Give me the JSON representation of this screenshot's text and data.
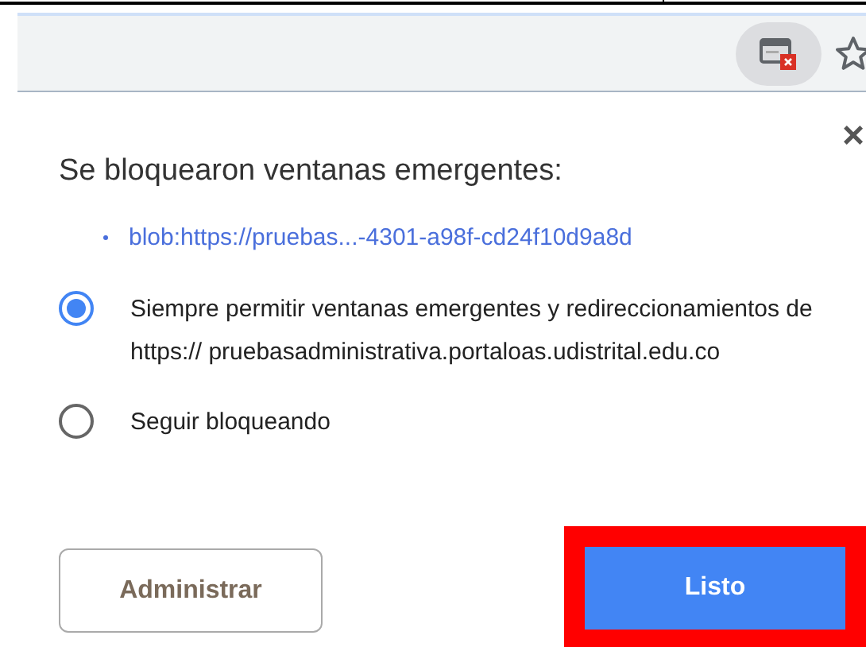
{
  "toolbar": {
    "popup_blocked_indicator": {
      "active": true
    }
  },
  "dialog": {
    "close": "×",
    "title": "Se bloquearon ventanas emergentes:",
    "blocked_links": [
      "blob:https://pruebas...-4301-a98f-cd24f10d9a8d"
    ],
    "options": [
      {
        "label": "Siempre permitir ventanas emergentes y redireccionamientos de https:// pruebasadministrativa.portaloas.udistrital.edu.co",
        "selected": true
      },
      {
        "label": "Seguir bloqueando",
        "selected": false
      }
    ],
    "buttons": [
      {
        "label": "Administrar",
        "kind": "secondary",
        "highlighted": false
      },
      {
        "label": "Listo",
        "kind": "primary",
        "highlighted": true
      }
    ]
  }
}
